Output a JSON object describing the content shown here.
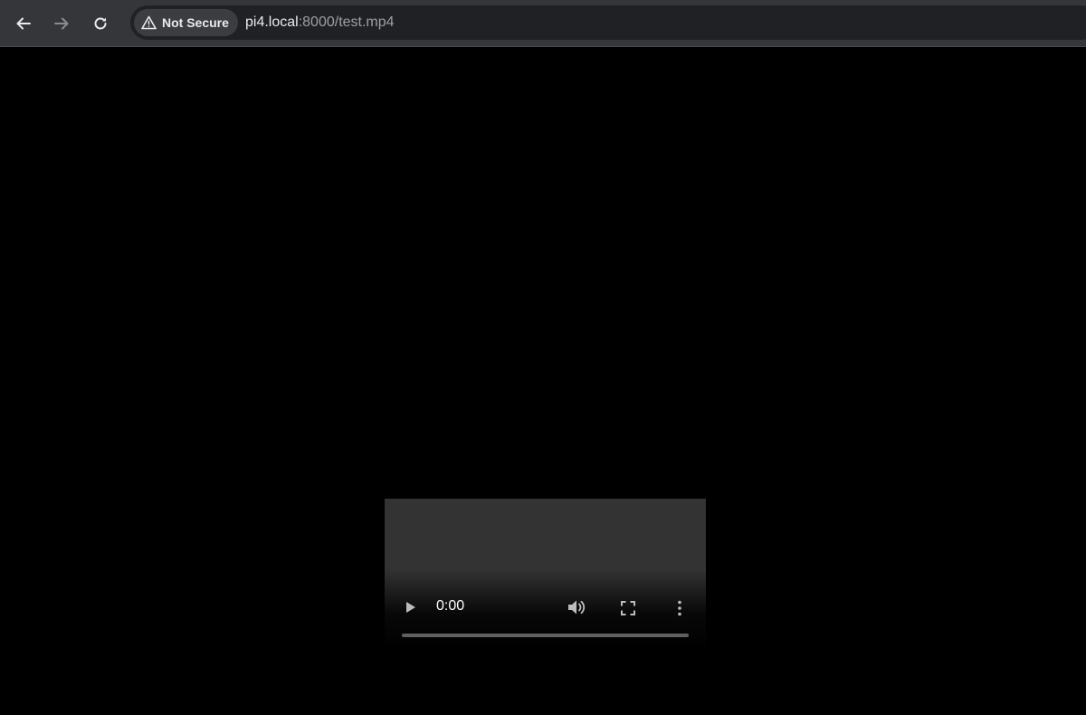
{
  "browser": {
    "back_icon": "arrow-left-icon",
    "forward_icon": "arrow-right-icon",
    "reload_icon": "reload-icon",
    "security": {
      "icon": "warning-triangle-icon",
      "label": "Not Secure"
    },
    "url": {
      "host": "pi4.local",
      "rest": ":8000/test.mp4"
    },
    "colors": {
      "toolbar": "#35363a",
      "omnibox": "#202124",
      "chip": "#3c3d41"
    }
  },
  "video_player": {
    "current_time": "0:00",
    "progress": 0,
    "icons": {
      "play": "play-icon",
      "volume": "volume-icon",
      "fullscreen": "fullscreen-icon",
      "more": "more-vertical-icon"
    },
    "colors": {
      "video_background": "#333333",
      "page_background": "#000000"
    }
  }
}
